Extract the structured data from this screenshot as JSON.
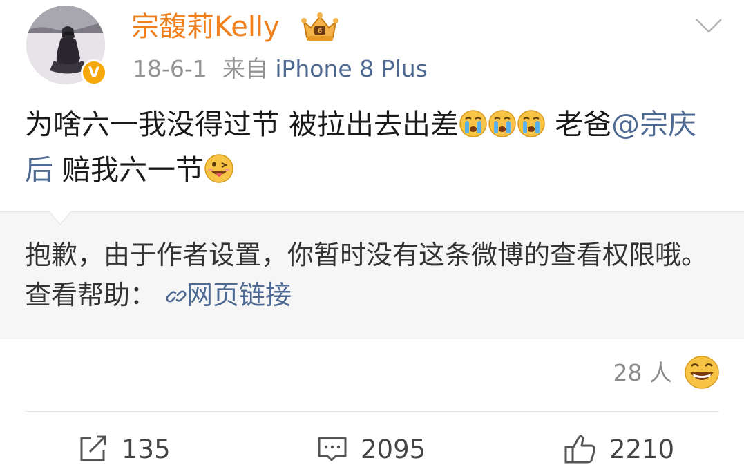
{
  "header": {
    "username": "宗馥莉Kelly",
    "date": "18-6-1",
    "source_prefix": "来自",
    "source_device": "iPhone 8 Plus",
    "verified_badge": "V",
    "icons": [
      "avatar",
      "verified-badge",
      "crown-icon",
      "chevron-down-icon"
    ]
  },
  "post": {
    "text_part1": "为啥六一我没得过节 被拉出去出差",
    "crying_emoji_count": 3,
    "text_part2": " 老爸",
    "mention": "@宗庆后",
    "text_part3": " 赔我六一节"
  },
  "notice": {
    "text": "抱歉，由于作者设置，你暂时没有这条微博的查看权限哦。查看帮助：",
    "link_label": "网页链接"
  },
  "reactions": {
    "count_label": "28 人",
    "emoji": "laughing-emoji"
  },
  "actions": {
    "repost_count": "135",
    "comment_count": "2095",
    "like_count": "2210"
  },
  "colors": {
    "username": "#f0801e",
    "link": "#4e6a92",
    "verified": "#f6a80c"
  }
}
